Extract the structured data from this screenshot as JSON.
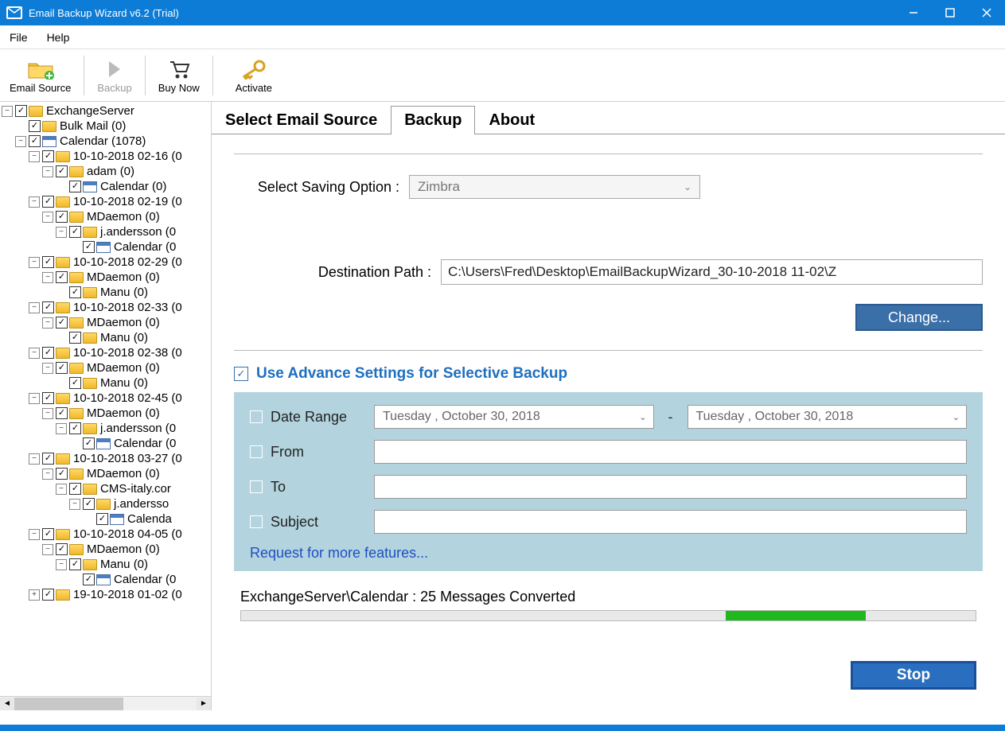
{
  "titlebar": {
    "title": "Email Backup Wizard v6.2 (Trial)"
  },
  "menu": {
    "file": "File",
    "help": "Help"
  },
  "toolbar": {
    "emailSource": "Email Source",
    "backup": "Backup",
    "buyNow": "Buy Now",
    "activate": "Activate"
  },
  "tabs": {
    "selectSource": "Select Email Source",
    "backup": "Backup",
    "about": "About"
  },
  "form": {
    "savingLabel": "Select Saving Option  :",
    "savingValue": "Zimbra",
    "destLabel": "Destination Path  :",
    "destValue": "C:\\Users\\Fred\\Desktop\\EmailBackupWizard_30-10-2018 11-02\\Z",
    "changeBtn": "Change..."
  },
  "advance": {
    "title": "Use Advance Settings for Selective Backup",
    "dateRange": "Date Range",
    "dateFrom": "Tuesday  ,   October    30, 2018",
    "dateTo": "Tuesday  ,   October    30, 2018",
    "from": "From",
    "to": "To",
    "subject": "Subject",
    "request": "Request for more features..."
  },
  "progress": {
    "label": "ExchangeServer\\Calendar : 25 Messages Converted",
    "stop": "Stop"
  },
  "tree": [
    {
      "ind": 0,
      "exp": "−",
      "icon": "folder",
      "label": "ExchangeServer"
    },
    {
      "ind": 1,
      "exp": "",
      "icon": "folder",
      "label": "Bulk Mail (0)"
    },
    {
      "ind": 1,
      "exp": "−",
      "icon": "calendar",
      "label": "Calendar (1078)"
    },
    {
      "ind": 2,
      "exp": "−",
      "icon": "folder",
      "label": "10-10-2018 02-16 (0"
    },
    {
      "ind": 3,
      "exp": "−",
      "icon": "folder",
      "label": "adam (0)"
    },
    {
      "ind": 4,
      "exp": "",
      "icon": "calendar",
      "label": "Calendar (0)"
    },
    {
      "ind": 2,
      "exp": "−",
      "icon": "folder",
      "label": "10-10-2018 02-19 (0"
    },
    {
      "ind": 3,
      "exp": "−",
      "icon": "folder",
      "label": "MDaemon (0)"
    },
    {
      "ind": 4,
      "exp": "−",
      "icon": "folder",
      "label": "j.andersson (0"
    },
    {
      "ind": 5,
      "exp": "",
      "icon": "calendar",
      "label": "Calendar (0"
    },
    {
      "ind": 2,
      "exp": "−",
      "icon": "folder",
      "label": "10-10-2018 02-29 (0"
    },
    {
      "ind": 3,
      "exp": "−",
      "icon": "folder",
      "label": "MDaemon (0)"
    },
    {
      "ind": 4,
      "exp": "",
      "icon": "folder",
      "label": "Manu (0)"
    },
    {
      "ind": 2,
      "exp": "−",
      "icon": "folder",
      "label": "10-10-2018 02-33 (0"
    },
    {
      "ind": 3,
      "exp": "−",
      "icon": "folder",
      "label": "MDaemon (0)"
    },
    {
      "ind": 4,
      "exp": "",
      "icon": "folder",
      "label": "Manu (0)"
    },
    {
      "ind": 2,
      "exp": "−",
      "icon": "folder",
      "label": "10-10-2018 02-38 (0"
    },
    {
      "ind": 3,
      "exp": "−",
      "icon": "folder",
      "label": "MDaemon (0)"
    },
    {
      "ind": 4,
      "exp": "",
      "icon": "folder",
      "label": "Manu (0)"
    },
    {
      "ind": 2,
      "exp": "−",
      "icon": "folder",
      "label": "10-10-2018 02-45 (0"
    },
    {
      "ind": 3,
      "exp": "−",
      "icon": "folder",
      "label": "MDaemon (0)"
    },
    {
      "ind": 4,
      "exp": "−",
      "icon": "folder",
      "label": "j.andersson (0"
    },
    {
      "ind": 5,
      "exp": "",
      "icon": "calendar",
      "label": "Calendar (0"
    },
    {
      "ind": 2,
      "exp": "−",
      "icon": "folder",
      "label": "10-10-2018 03-27 (0"
    },
    {
      "ind": 3,
      "exp": "−",
      "icon": "folder",
      "label": "MDaemon (0)"
    },
    {
      "ind": 4,
      "exp": "−",
      "icon": "folder",
      "label": "CMS-italy.cor"
    },
    {
      "ind": 5,
      "exp": "−",
      "icon": "folder",
      "label": "j.andersso"
    },
    {
      "ind": 5,
      "exp": "",
      "icon": "calendar",
      "label": "Calenda",
      "extraInd": true
    },
    {
      "ind": 2,
      "exp": "−",
      "icon": "folder",
      "label": "10-10-2018 04-05 (0"
    },
    {
      "ind": 3,
      "exp": "−",
      "icon": "folder",
      "label": "MDaemon (0)"
    },
    {
      "ind": 4,
      "exp": "−",
      "icon": "folder",
      "label": "Manu (0)"
    },
    {
      "ind": 5,
      "exp": "",
      "icon": "calendar",
      "label": "Calendar (0"
    },
    {
      "ind": 2,
      "exp": "+",
      "icon": "folder",
      "label": "19-10-2018 01-02 (0"
    }
  ]
}
